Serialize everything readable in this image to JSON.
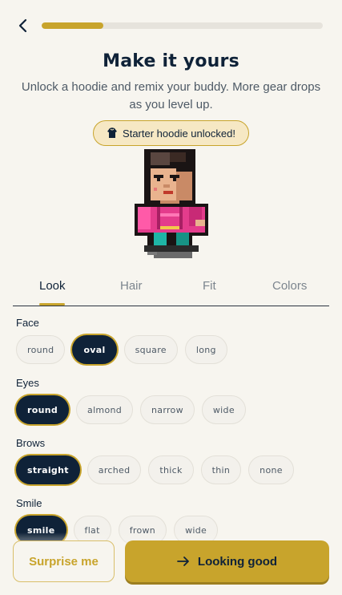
{
  "header": {
    "progress_percent": 22
  },
  "title": "Make it yours",
  "subtitle": "Unlock a hoodie and remix your buddy. More gear drops as you level up.",
  "badge": {
    "icon": "hoodie-icon",
    "text": "Starter hoodie unlocked!"
  },
  "tabs": [
    {
      "label": "Look",
      "active": true
    },
    {
      "label": "Hair",
      "active": false
    },
    {
      "label": "Fit",
      "active": false
    },
    {
      "label": "Colors",
      "active": false
    }
  ],
  "sections": {
    "face": {
      "label": "Face",
      "options": [
        "round",
        "oval",
        "square",
        "long"
      ],
      "selected": "oval"
    },
    "eyes": {
      "label": "Eyes",
      "options": [
        "round",
        "almond",
        "narrow",
        "wide"
      ],
      "selected": "round"
    },
    "brows": {
      "label": "Brows",
      "options": [
        "straight",
        "arched",
        "thick",
        "thin",
        "none"
      ],
      "selected": "straight"
    },
    "smile": {
      "label": "Smile",
      "options": [
        "smile",
        "flat",
        "frown",
        "wide"
      ],
      "selected": "smile"
    }
  },
  "actions": {
    "surprise_label": "Surprise me",
    "primary_label": "Looking good",
    "primary_icon": "arrow-right-icon"
  },
  "colors": {
    "accent": "#c8a42c",
    "ink": "#0f2238",
    "background": "#f7f5ef",
    "hoodie": "#e43c8c"
  }
}
